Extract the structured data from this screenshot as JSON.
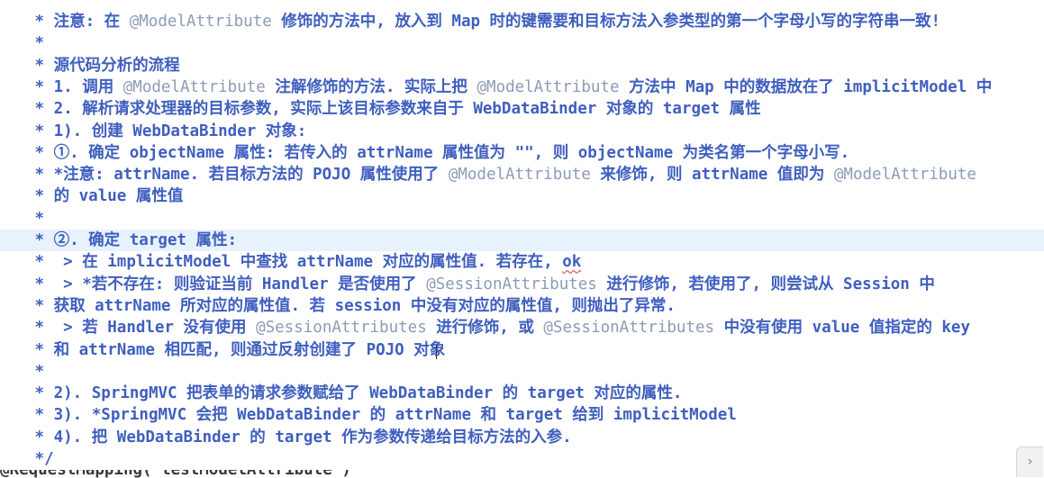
{
  "editor": {
    "lines": [
      {
        "segments": [
          {
            "t": " * 注意: 在 "
          },
          {
            "t": "@ModelAttribute",
            "c": "ann"
          },
          {
            "t": " 修饰的方法中, 放入到 Map 时的键需要和目标方法入参类型的第一个字母小写的字符串一致!"
          }
        ]
      },
      {
        "segments": [
          {
            "t": " *"
          }
        ]
      },
      {
        "segments": [
          {
            "t": " * 源代码分析的流程"
          }
        ]
      },
      {
        "segments": [
          {
            "t": " * 1. 调用 "
          },
          {
            "t": "@ModelAttribute",
            "c": "ann"
          },
          {
            "t": " 注解修饰的方法. 实际上把 "
          },
          {
            "t": "@ModelAttribute",
            "c": "ann"
          },
          {
            "t": " 方法中 Map 中的数据放在了 implicitModel 中"
          }
        ]
      },
      {
        "segments": [
          {
            "t": " * 2. 解析请求处理器的目标参数, 实际上该目标参数来自于 WebDataBinder 对象的 target 属性"
          }
        ]
      },
      {
        "segments": [
          {
            "t": " * 1). 创建 WebDataBinder 对象:"
          }
        ]
      },
      {
        "segments": [
          {
            "t": " * ①. 确定 objectName 属性: 若传入的 attrName 属性值为 \"\", 则 objectName 为类名第一个字母小写."
          }
        ]
      },
      {
        "segments": [
          {
            "t": " * *注意: attrName. 若目标方法的 POJO 属性使用了 "
          },
          {
            "t": "@ModelAttribute",
            "c": "ann"
          },
          {
            "t": " 来修饰, 则 attrName 值即为 "
          },
          {
            "t": "@ModelAttribute",
            "c": "ann"
          }
        ]
      },
      {
        "segments": [
          {
            "t": " * 的 value 属性值"
          }
        ]
      },
      {
        "segments": [
          {
            "t": " *"
          }
        ]
      },
      {
        "current": true,
        "segments": [
          {
            "t": " * ②. 确定 target 属性:"
          }
        ]
      },
      {
        "segments": [
          {
            "t": " *  > 在 implicitModel 中查找 attrName 对应的属性值. 若存在, "
          },
          {
            "t": "ok",
            "c": "squiggle"
          }
        ]
      },
      {
        "segments": [
          {
            "t": " *  > *若不存在: 则验证当前 Handler 是否使用了 "
          },
          {
            "t": "@SessionAttributes",
            "c": "ann"
          },
          {
            "t": " 进行修饰, 若使用了, 则尝试从 Session 中"
          }
        ]
      },
      {
        "segments": [
          {
            "t": " * 获取 attrName 所对应的属性值. 若 session 中没有对应的属性值, 则抛出了异常."
          }
        ]
      },
      {
        "segments": [
          {
            "t": " *  > 若 Handler 没有使用 "
          },
          {
            "t": "@SessionAttributes",
            "c": "ann"
          },
          {
            "t": " 进行修饰, 或 "
          },
          {
            "t": "@SessionAttributes",
            "c": "ann"
          },
          {
            "t": " 中没有使用 value 值指定的 key"
          }
        ]
      },
      {
        "segments": [
          {
            "t": " * 和 attrName 相匹配, 则通过反射创建了 POJO 对象"
          }
        ]
      },
      {
        "segments": [
          {
            "t": " *"
          }
        ]
      },
      {
        "segments": [
          {
            "t": " * 2). SpringMVC 把表单的请求参数赋给了 WebDataBinder 的 target 对应的属性."
          }
        ]
      },
      {
        "segments": [
          {
            "t": " * 3). *SpringMVC 会把 WebDataBinder 的 attrName 和 target 给到 implicitModel"
          }
        ]
      },
      {
        "segments": [
          {
            "t": " * 4). 把 WebDataBinder 的 target 作为参数传递给目标方法的入参."
          }
        ]
      },
      {
        "segments": [
          {
            "t": " */"
          }
        ]
      }
    ],
    "cutoff_line": "@RequestMapping(\"testModelAttribute\")"
  },
  "colors": {
    "comment_text": "#3f5fbf",
    "annotation_text": "#8c9bb8",
    "current_line_bg": "#e8f2fe",
    "background": "#ffffff"
  },
  "overlay": {
    "icon": "overlay-arrow-icon",
    "label": "›"
  }
}
